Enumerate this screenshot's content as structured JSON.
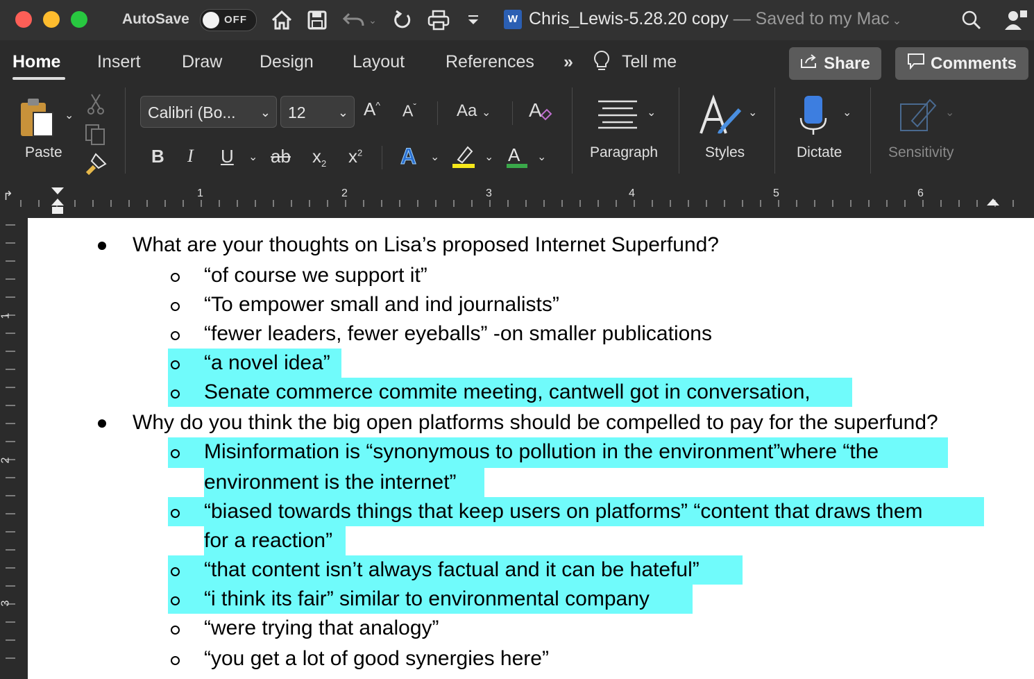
{
  "titlebar": {
    "autosave_label": "AutoSave",
    "autosave_state": "OFF",
    "doc_name": "Chris_Lewis-5.28.20 copy",
    "save_status": " — Saved to my Mac",
    "icons": [
      "home-icon",
      "save-icon",
      "undo-icon",
      "redo-icon",
      "print-icon",
      "customize-icon",
      "search-icon",
      "user-icon"
    ]
  },
  "tabs": [
    "Home",
    "Insert",
    "Draw",
    "Design",
    "Layout",
    "References"
  ],
  "overflow": "»",
  "tell_me": "Tell me",
  "share_label": "Share",
  "comments_label": "Comments",
  "toolbar": {
    "paste_label": "Paste",
    "font_name": "Calibri (Bo...",
    "font_size": "12",
    "grow": "A",
    "shrink": "A",
    "case": "Aa",
    "bold": "B",
    "italic": "I",
    "underline": "U",
    "strike": "ab",
    "sub": "x",
    "sup": "x",
    "paragraph_label": "Paragraph",
    "styles_label": "Styles",
    "dictate_label": "Dictate",
    "sensitivity_label": "Sensitivity"
  },
  "ruler": [
    "1",
    "2",
    "3",
    "4",
    "5",
    "6"
  ],
  "vruler": [
    "1",
    "2",
    "3"
  ],
  "document": {
    "q1": "What are your thoughts on Lisa’s proposed Internet Superfund?",
    "q1_items": [
      "“of course we support it”",
      "“To empower small and ind journalists”",
      "“fewer leaders, fewer eyeballs” -on smaller publications",
      "“a novel idea”",
      "Senate commerce commite meeting, cantwell got in conversation,"
    ],
    "q2": "Why do you think the big open platforms should be compelled to pay for the superfund?",
    "q2_items": [
      "Misinformation is “synonymous to pollution in the environment”where “the",
      "environment is the internet”",
      "“biased towards things that keep users on platforms” “content that draws them",
      "for a reaction”",
      "“that content isn’t always factual and it can be hateful”",
      "“i think its fair” similar to environmental company",
      "“were trying that analogy”",
      "“you get a lot of good synergies here”"
    ]
  }
}
